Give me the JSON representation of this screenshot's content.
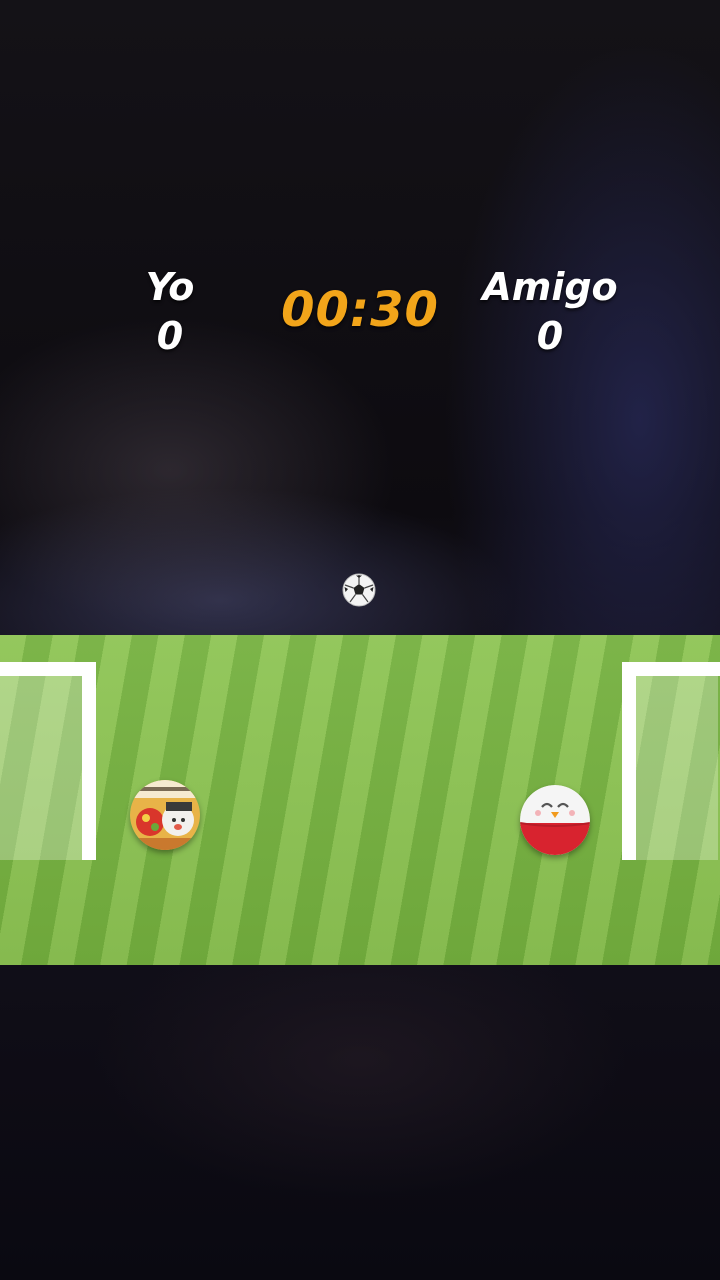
{
  "hud": {
    "player1": {
      "name": "Yo",
      "score": "0"
    },
    "player2": {
      "name": "Amigo",
      "score": "0"
    },
    "timer": "00:30",
    "timer_color": "#f2a51a"
  },
  "pitch": {
    "stripe_light": "#8dc453",
    "stripe_dark": "#74b03e"
  },
  "game_objects": {
    "ball_icon": "soccer-ball-icon",
    "player_left_icon": "custom-photo-avatar",
    "player_right_icon": "red-white-bird-ball-icon"
  }
}
